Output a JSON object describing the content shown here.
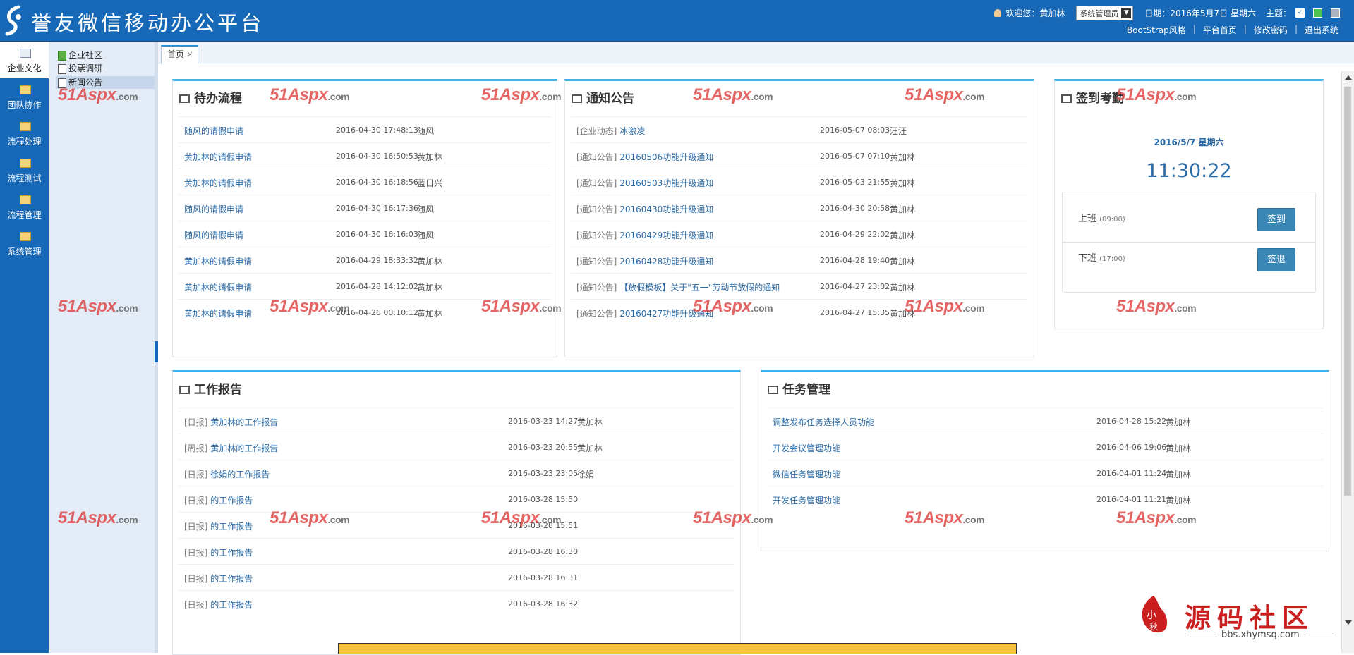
{
  "header": {
    "title": "誉友微信移动办公平台",
    "welcome_label": "欢迎您：",
    "user_name": "黄加林",
    "role": "系统管理员",
    "date_label": "日期：",
    "date_value": "2016年5月7日 星期六",
    "theme_label": "主题：",
    "links": [
      "BootStrap风格",
      "平台首页",
      "修改密码",
      "退出系统"
    ],
    "link_separator": "|"
  },
  "left_nav": {
    "items": [
      {
        "label": "企业文化",
        "active": true
      },
      {
        "label": "团队协作"
      },
      {
        "label": "流程处理"
      },
      {
        "label": "流程测试"
      },
      {
        "label": "流程管理"
      },
      {
        "label": "系统管理"
      }
    ]
  },
  "tree": {
    "items": [
      "企业社区",
      "投票调研",
      "新闻公告"
    ]
  },
  "tabs": {
    "home": "首页",
    "close": "×"
  },
  "todo": {
    "title": "待办流程",
    "rows": [
      {
        "name": "随风的请假申请",
        "time": "2016-04-30 17:48:13",
        "user": "随风"
      },
      {
        "name": "黄加林的请假申请",
        "time": "2016-04-30 16:50:53",
        "user": "黄加林"
      },
      {
        "name": "黄加林的请假申请",
        "time": "2016-04-30 16:18:56",
        "user": "蓝日兴"
      },
      {
        "name": "随风的请假申请",
        "time": "2016-04-30 16:17:36",
        "user": "随风"
      },
      {
        "name": "随风的请假申请",
        "time": "2016-04-30 16:16:03",
        "user": "随风"
      },
      {
        "name": "黄加林的请假申请",
        "time": "2016-04-29 18:33:32",
        "user": "黄加林"
      },
      {
        "name": "黄加林的请假申请",
        "time": "2016-04-28 14:12:02",
        "user": "黄加林"
      },
      {
        "name": "黄加林的请假申请",
        "time": "2016-04-26 00:10:12",
        "user": "黄加林"
      }
    ]
  },
  "notices": {
    "title": "通知公告",
    "rows": [
      {
        "category": "[企业动态]",
        "title": "冰激凌",
        "time": "2016-05-07 08:03",
        "user": "汪汪"
      },
      {
        "category": "[通知公告]",
        "title": "20160506功能升级通知",
        "time": "2016-05-07 07:10",
        "user": "黄加林"
      },
      {
        "category": "[通知公告]",
        "title": "20160503功能升级通知",
        "time": "2016-05-03 21:55",
        "user": "黄加林"
      },
      {
        "category": "[通知公告]",
        "title": "20160430功能升级通知",
        "time": "2016-04-30 20:58",
        "user": "黄加林"
      },
      {
        "category": "[通知公告]",
        "title": "20160429功能升级通知",
        "time": "2016-04-29 22:02",
        "user": "黄加林"
      },
      {
        "category": "[通知公告]",
        "title": "20160428功能升级通知",
        "time": "2016-04-28 19:40",
        "user": "黄加林"
      },
      {
        "category": "[通知公告]",
        "title": "【放假模板】关于\"五一\"劳动节放假的通知",
        "time": "2016-04-27 23:02",
        "user": "黄加林"
      },
      {
        "category": "[通知公告]",
        "title": "20160427功能升级通知",
        "time": "2016-04-27 15:35",
        "user": "黄加林"
      }
    ]
  },
  "attendance": {
    "title": "签到考勤",
    "date": "2016/5/7  星期六",
    "clock": "11:30:22",
    "checkin_label": "上班",
    "checkin_time": "(09:00)",
    "checkin_button": "签到",
    "checkout_label": "下班",
    "checkout_time": "(17:00)",
    "checkout_button": "签退"
  },
  "reports": {
    "title": "工作报告",
    "rows": [
      {
        "category": "[日报]",
        "title": "黄加林的工作报告",
        "time": "2016-03-23 14:27",
        "user": "黄加林"
      },
      {
        "category": "[周报]",
        "title": "黄加林的工作报告",
        "time": "2016-03-23 20:55",
        "user": "黄加林"
      },
      {
        "category": "[日报]",
        "title": "徐娟的工作报告",
        "time": "2016-03-23 23:05",
        "user": "徐娟"
      },
      {
        "category": "[日报]",
        "title": "的工作报告",
        "time": "2016-03-28 15:50",
        "user": ""
      },
      {
        "category": "[日报]",
        "title": "的工作报告",
        "time": "2016-03-28 15:51",
        "user": ""
      },
      {
        "category": "[日报]",
        "title": "的工作报告",
        "time": "2016-03-28 16:30",
        "user": ""
      },
      {
        "category": "[日报]",
        "title": "的工作报告",
        "time": "2016-03-28 16:31",
        "user": ""
      },
      {
        "category": "[日报]",
        "title": "的工作报告",
        "time": "2016-03-28 16:32",
        "user": ""
      }
    ]
  },
  "tasks": {
    "title": "任务管理",
    "rows": [
      {
        "title": "调整发布任务选择人员功能",
        "time": "2016-04-28 15:22",
        "user": "黄加林"
      },
      {
        "title": "开发会议管理功能",
        "time": "2016-04-06 19:06",
        "user": "黄加林"
      },
      {
        "title": "微信任务管理功能",
        "time": "2016-04-01 11:24",
        "user": "黄加林"
      },
      {
        "title": "开发任务管理功能",
        "time": "2016-04-01 11:21",
        "user": "黄加林"
      }
    ]
  },
  "watermark": {
    "text": "51Aspx",
    "suffix": ".com"
  },
  "stamp": {
    "name": "源码社区",
    "url": "bbs.xhymsq.com"
  },
  "colors": {
    "header_bg": "#1769b8",
    "panel_accent": "#3db2e8",
    "link": "#2a6aa6",
    "button": "#3a86b5"
  }
}
